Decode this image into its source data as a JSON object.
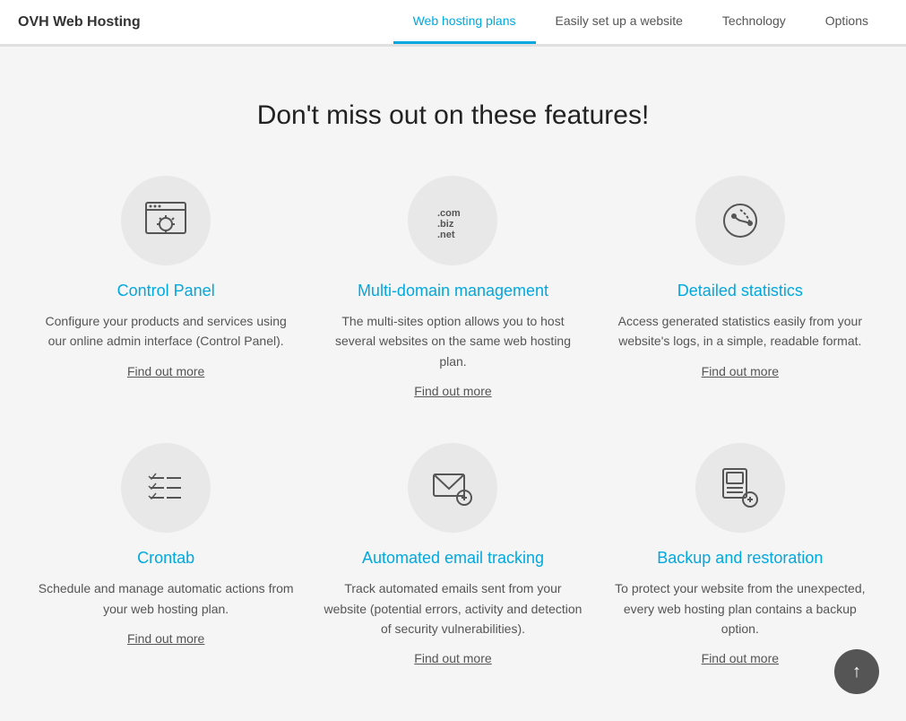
{
  "nav": {
    "brand": "OVH Web Hosting",
    "links": [
      {
        "label": "Web hosting plans",
        "active": true
      },
      {
        "label": "Easily set up a website",
        "active": false
      },
      {
        "label": "Technology",
        "active": false
      },
      {
        "label": "Options",
        "active": false
      }
    ]
  },
  "section": {
    "title": "Don't miss out on these features!"
  },
  "features": [
    {
      "id": "control-panel",
      "title": "Control Panel",
      "description": "Configure your products and services using our online admin interface (Control Panel).",
      "link": "Find out more"
    },
    {
      "id": "multi-domain",
      "title": "Multi-domain management",
      "description": "The multi-sites option allows you to host several websites on the same web hosting plan.",
      "link": "Find out more"
    },
    {
      "id": "detailed-statistics",
      "title": "Detailed statistics",
      "description": "Access generated statistics easily from your website's logs, in a simple, readable format.",
      "link": "Find out more"
    },
    {
      "id": "crontab",
      "title": "Crontab",
      "description": "Schedule and manage automatic actions from your web hosting plan.",
      "link": "Find out more"
    },
    {
      "id": "automated-email",
      "title": "Automated email tracking",
      "description": "Track automated emails sent from your website (potential errors, activity and detection of security vulnerabilities).",
      "link": "Find out more"
    },
    {
      "id": "backup-restoration",
      "title": "Backup and restoration",
      "description": "To protect your website from the unexpected, every web hosting plan contains a backup option.",
      "link": "Find out more"
    }
  ],
  "back_to_top_label": "↑"
}
